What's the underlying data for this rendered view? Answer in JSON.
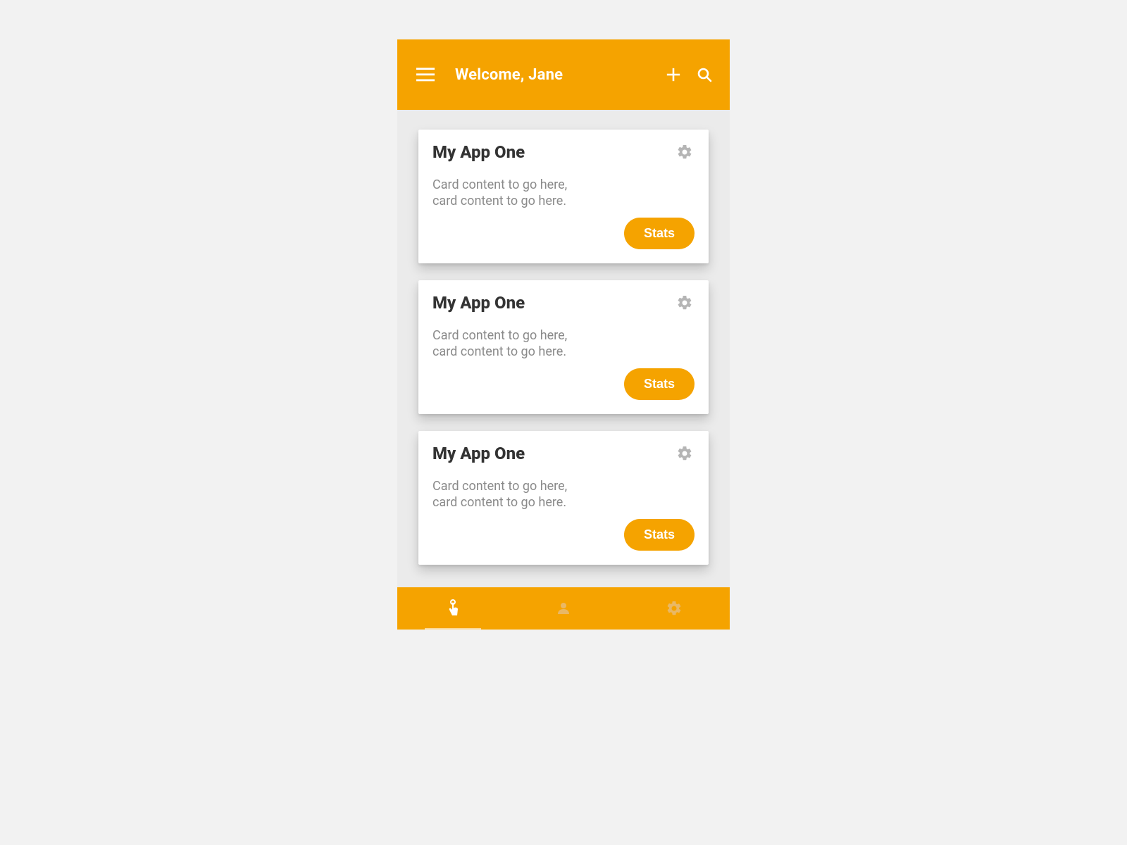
{
  "colors": {
    "brand": "#f5a300",
    "background": "#f2f2f2",
    "deviceBg": "#ebebeb",
    "cardBg": "#ffffff",
    "titleText": "#333333",
    "bodyText": "#8a8a8a",
    "muted": "#b5b5b5",
    "onBrand": "#ffffff"
  },
  "header": {
    "title": "Welcome, Jane"
  },
  "cards": [
    {
      "title": "My App One",
      "body_line1": "Card content to go here,",
      "body_line2": "card content to go here.",
      "action_label": "Stats"
    },
    {
      "title": "My App One",
      "body_line1": "Card content to go here,",
      "body_line2": "card content to go here.",
      "action_label": "Stats"
    },
    {
      "title": "My App One",
      "body_line1": "Card content to go here,",
      "body_line2": "card content to go here.",
      "action_label": "Stats"
    }
  ],
  "bottom_nav": {
    "items": [
      "touch",
      "profile",
      "settings"
    ],
    "active_index": 0
  }
}
